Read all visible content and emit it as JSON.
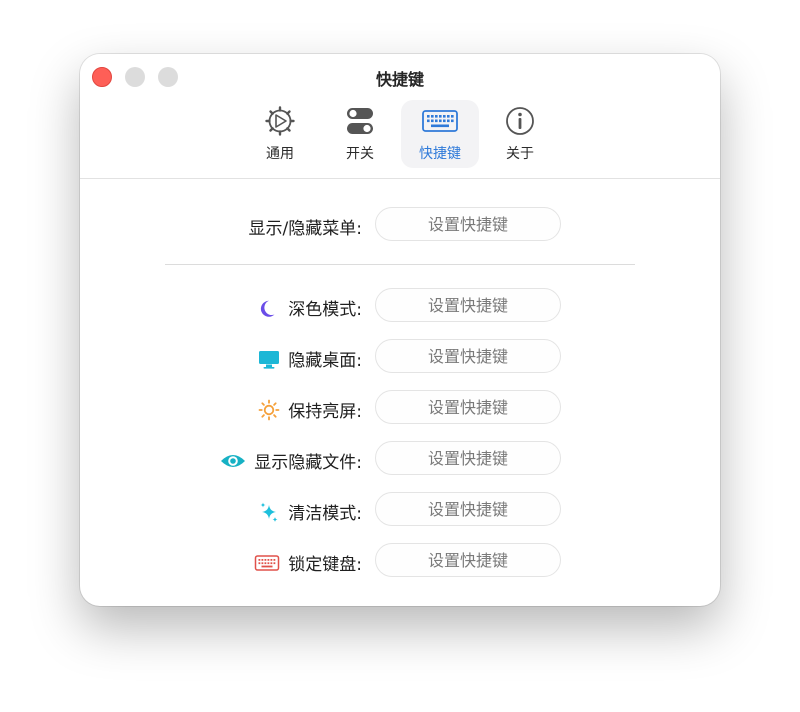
{
  "window": {
    "title": "快捷键"
  },
  "tabs": [
    {
      "label": "通用",
      "icon": "gear-icon",
      "active": false
    },
    {
      "label": "开关",
      "icon": "toggle-icon",
      "active": false
    },
    {
      "label": "快捷键",
      "icon": "keyboard-icon",
      "active": true
    },
    {
      "label": "关于",
      "icon": "info-icon",
      "active": false
    }
  ],
  "menu_shortcut": {
    "label": "显示/隐藏菜单:",
    "button": "设置快捷键"
  },
  "shortcuts": [
    {
      "label": "深色模式:",
      "icon": "moon-icon",
      "icon_color": "#6a4de8",
      "button": "设置快捷键"
    },
    {
      "label": "隐藏桌面:",
      "icon": "monitor-icon",
      "icon_color": "#1cb7d6",
      "button": "设置快捷键"
    },
    {
      "label": "保持亮屏:",
      "icon": "sun-icon",
      "icon_color": "#f5a03a",
      "button": "设置快捷键"
    },
    {
      "label": "显示隐藏文件:",
      "icon": "eye-icon",
      "icon_color": "#17b1c4",
      "button": "设置快捷键"
    },
    {
      "label": "清洁模式:",
      "icon": "sparkle-icon",
      "icon_color": "#1ec0dc",
      "button": "设置快捷键"
    },
    {
      "label": "锁定键盘:",
      "icon": "keyboard-icon",
      "icon_color": "#e0514a",
      "button": "设置快捷键"
    }
  ],
  "colors": {
    "accent": "#2f7ad9",
    "close": "#fe5f57"
  }
}
